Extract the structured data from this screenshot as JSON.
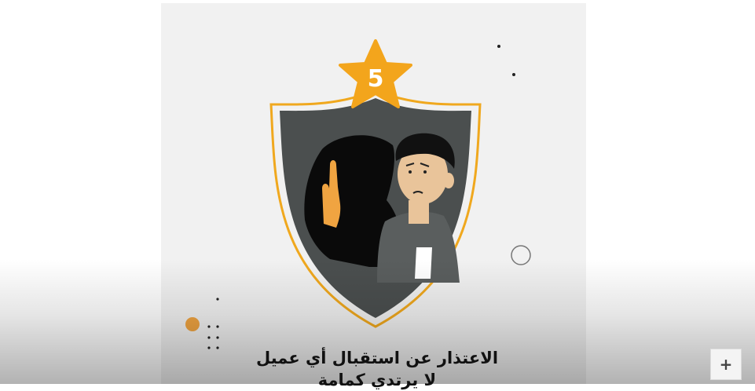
{
  "video": {
    "badge_number": "5",
    "caption_line1": "الاعتذار عن استقبال أي عميل",
    "caption_line2": "لا يرتدي كمامة"
  },
  "controls": {
    "expand_label": "+"
  },
  "colors": {
    "frame_bg": "#f1f1f1",
    "shield_dark": "#4b4f4f",
    "shield_border": "#f0a81e",
    "star": "#f3a51c",
    "skin": "#e9c49a",
    "hand": "#f0a441"
  },
  "icons": [
    "star-badge-icon",
    "shield-icon",
    "raised-hand-icon",
    "circle-outline-icon",
    "plus-icon"
  ]
}
